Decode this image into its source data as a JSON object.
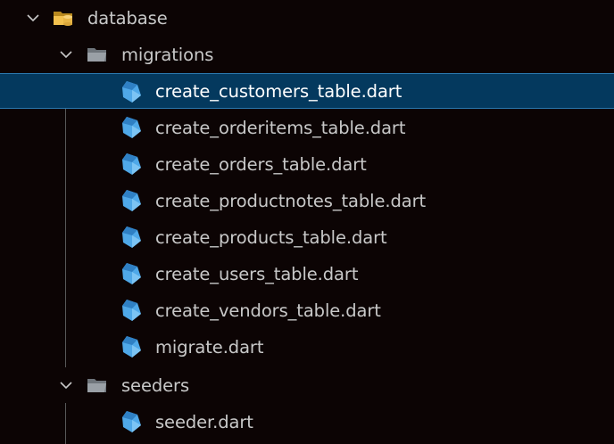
{
  "tree": {
    "root": {
      "label": "database",
      "icon": "database-folder-open-icon",
      "expanded": true
    },
    "migrations": {
      "label": "migrations",
      "icon": "folder-open-icon",
      "expanded": true,
      "files": [
        {
          "label": "create_customers_table.dart",
          "icon": "dart-icon",
          "selected": true
        },
        {
          "label": "create_orderitems_table.dart",
          "icon": "dart-icon"
        },
        {
          "label": "create_orders_table.dart",
          "icon": "dart-icon"
        },
        {
          "label": "create_productnotes_table.dart",
          "icon": "dart-icon"
        },
        {
          "label": "create_products_table.dart",
          "icon": "dart-icon"
        },
        {
          "label": "create_users_table.dart",
          "icon": "dart-icon"
        },
        {
          "label": "create_vendors_table.dart",
          "icon": "dart-icon"
        },
        {
          "label": "migrate.dart",
          "icon": "dart-icon"
        }
      ]
    },
    "seeders": {
      "label": "seeders",
      "icon": "folder-open-icon",
      "expanded": true,
      "files": [
        {
          "label": "seeder.dart",
          "icon": "dart-icon"
        }
      ]
    }
  },
  "colors": {
    "background": "#0c0404",
    "selection": "#04395e",
    "selection_border": "#2b79b0",
    "text": "#c8c8c8",
    "dart_blue": "#4fa8e8",
    "folder_gray": "#9aa0a6",
    "database_folder_yellow": "#f2c14e"
  }
}
